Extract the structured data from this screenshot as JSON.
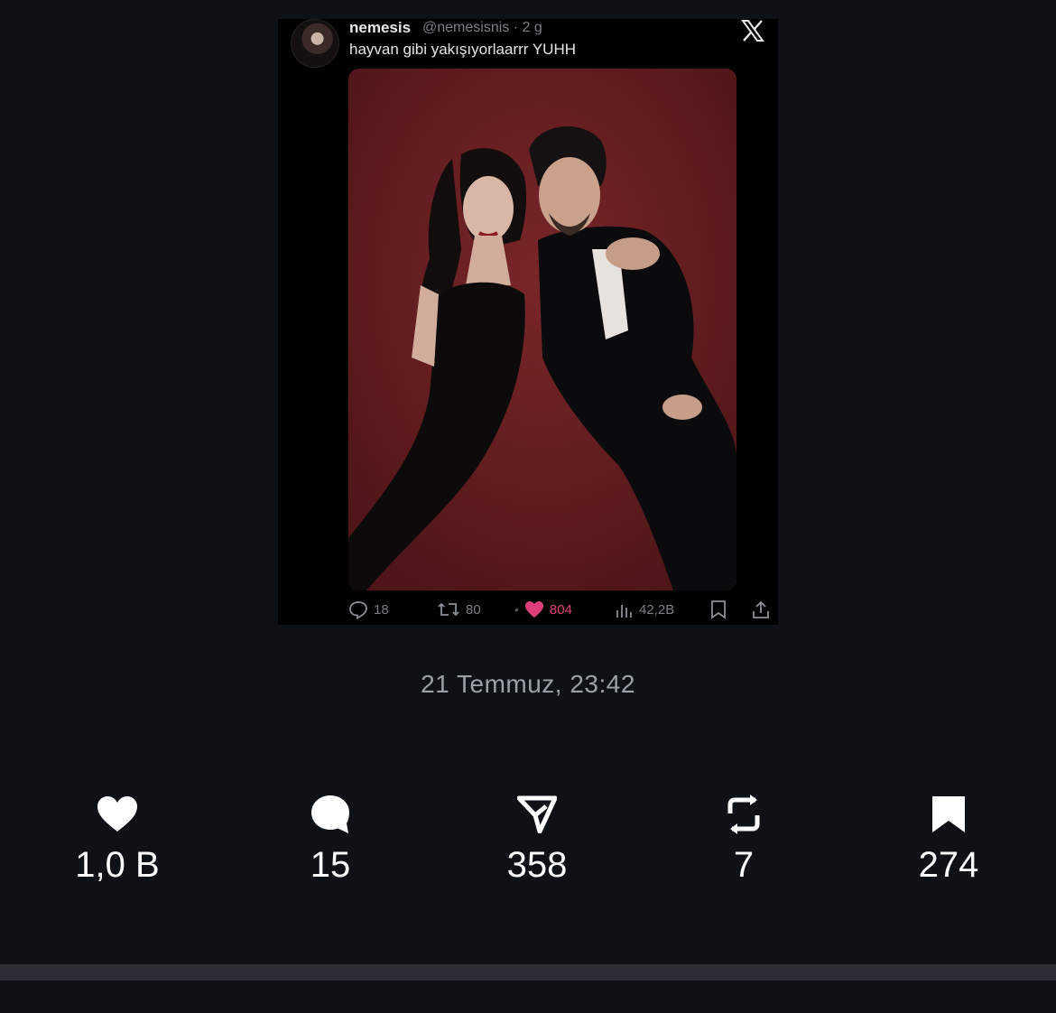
{
  "embedded_tweet": {
    "name": "nemesis",
    "handle_time": "@nemesisnis · 2 g",
    "text": "hayvan gibi yakışıyorlaarrr YUHH",
    "actions": {
      "replies": "18",
      "retweets": "80",
      "likes": "804",
      "views": "42,2B"
    }
  },
  "timestamp": "21 Temmuz, 23:42",
  "stats": {
    "likes": "1,0 B",
    "comments": "15",
    "shares": "358",
    "reposts": "7",
    "saves": "274"
  },
  "colors": {
    "background": "#0e1116",
    "like_accent": "#e0407a",
    "photo_backdrop": "#6a1f22"
  }
}
